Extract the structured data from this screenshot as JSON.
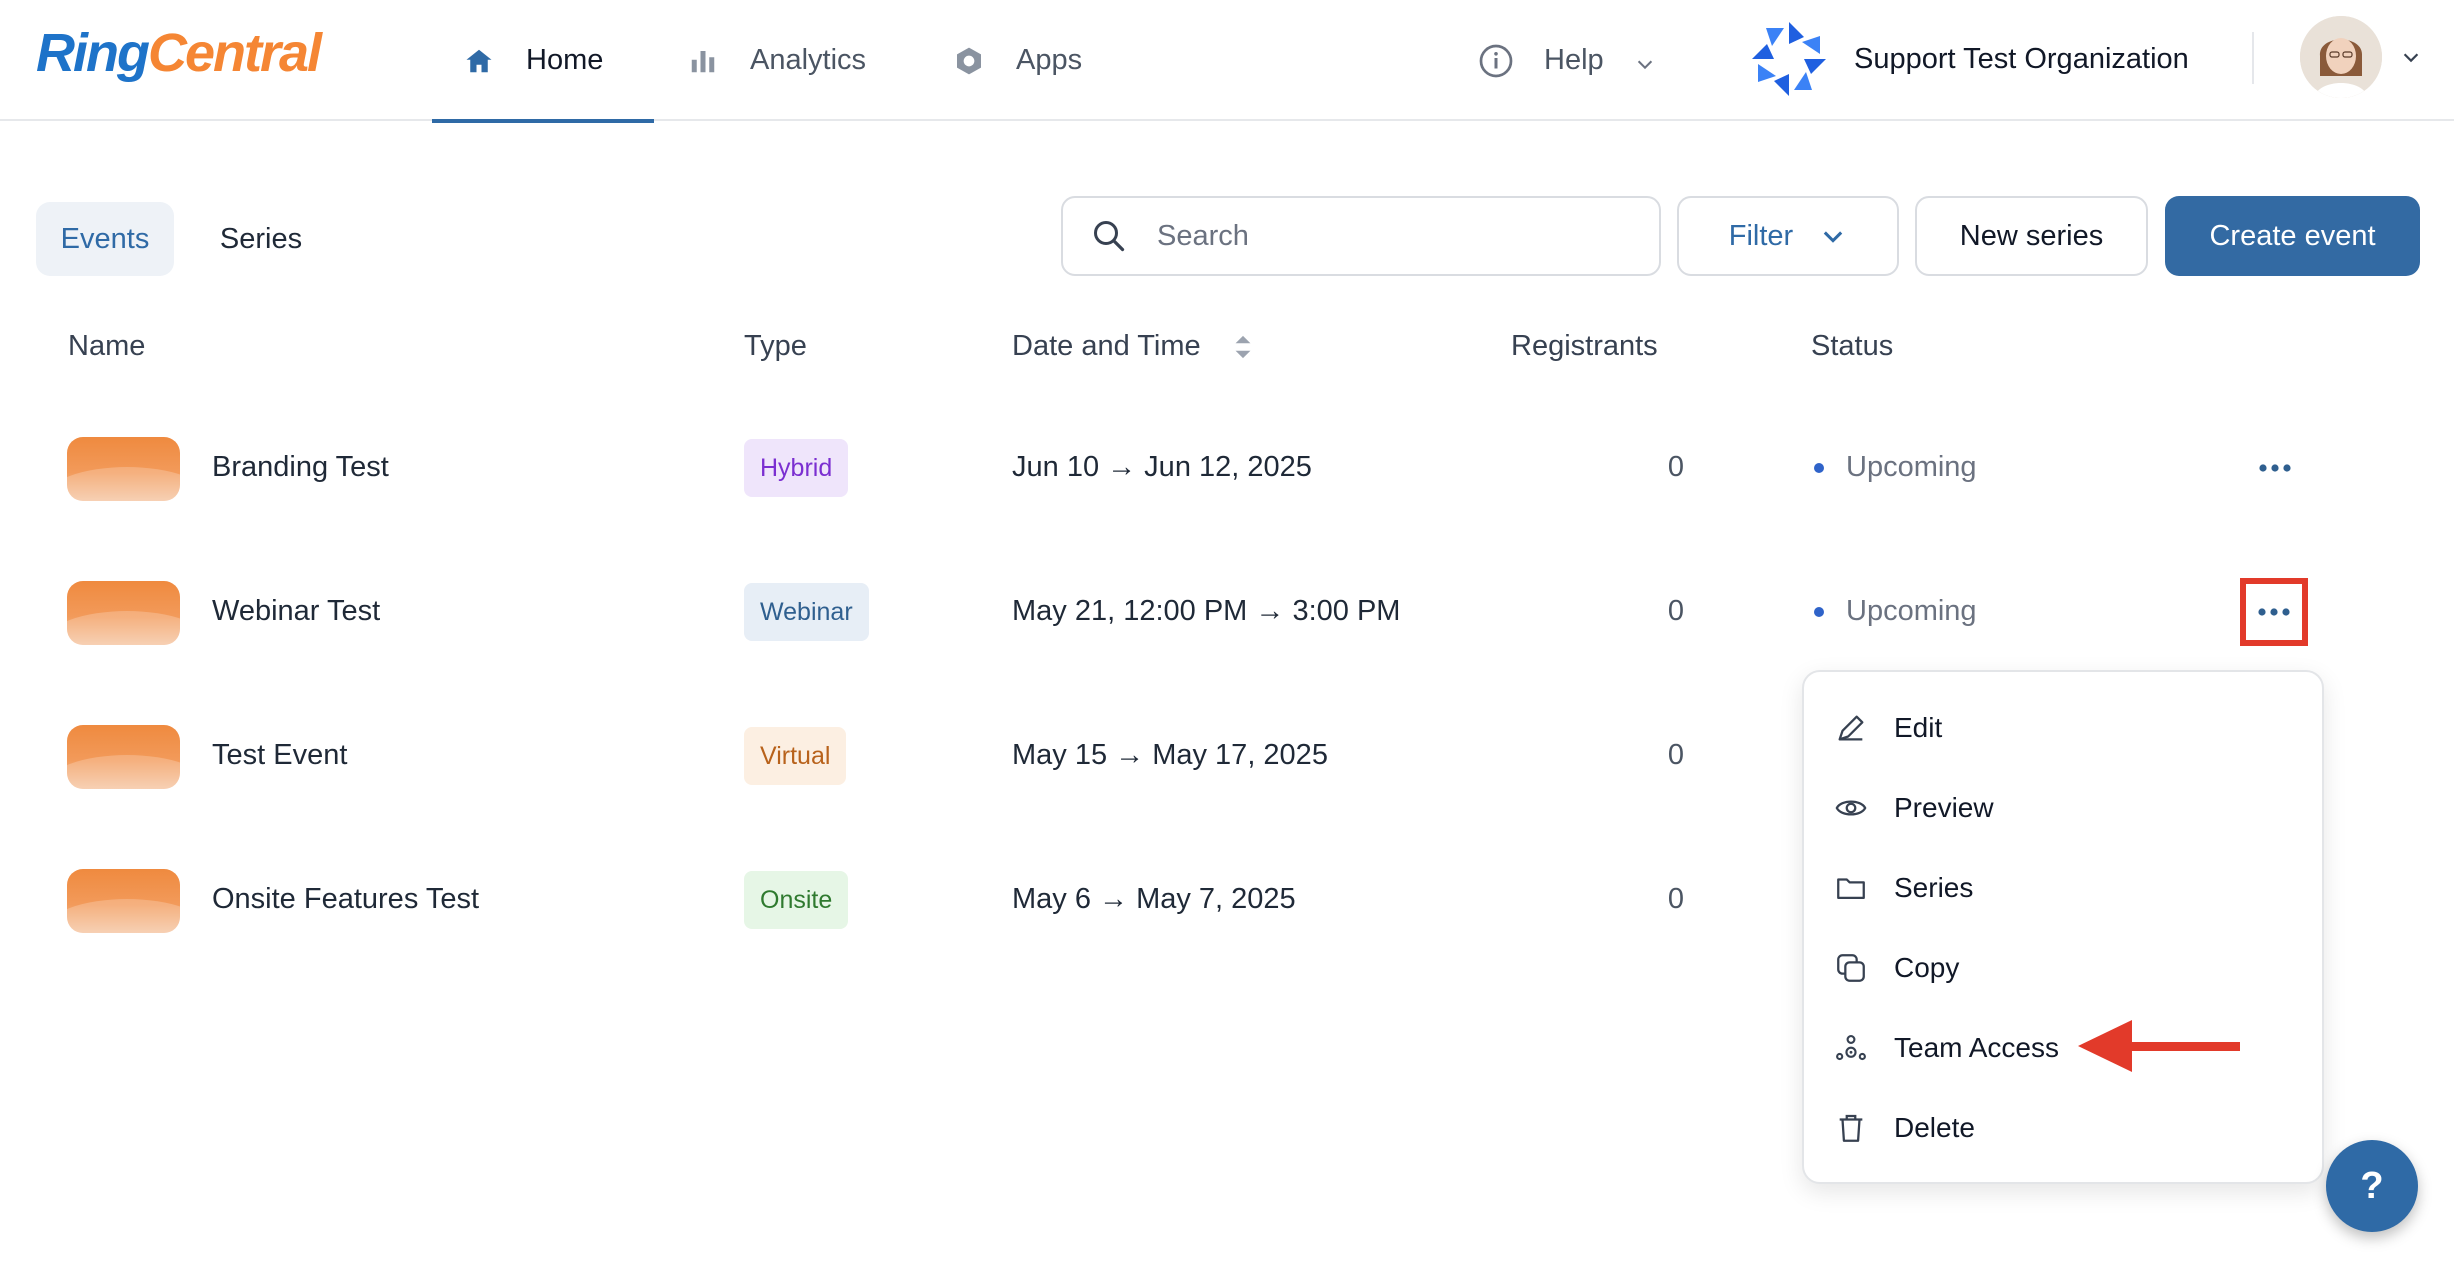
{
  "brand": {
    "part1": "Ring",
    "part2": "Central",
    "colors": {
      "blue": "#1e73c9",
      "orange": "#f58634"
    }
  },
  "nav": {
    "home": "Home",
    "analytics": "Analytics",
    "apps": "Apps",
    "help": "Help",
    "organization": "Support Test Organization"
  },
  "toolbar": {
    "tab_events": "Events",
    "tab_series": "Series",
    "search_placeholder": "Search",
    "filter_label": "Filter",
    "new_series_label": "New series",
    "create_event_label": "Create event",
    "accent": "#336aa3"
  },
  "table": {
    "columns": {
      "name": "Name",
      "type": "Type",
      "date": "Date and Time",
      "registrants": "Registrants",
      "status": "Status"
    },
    "rows": [
      {
        "name": "Branding Test",
        "type": "Hybrid",
        "date": "Jun 10 → Jun 12, 2025",
        "registrants": "0",
        "status": "Upcoming"
      },
      {
        "name": "Webinar Test",
        "type": "Webinar",
        "date": "May 21, 12:00 PM → 3:00 PM",
        "registrants": "0",
        "status": "Upcoming"
      },
      {
        "name": "Test Event",
        "type": "Virtual",
        "date": "May 15 → May 17, 2025",
        "registrants": "0",
        "status": ""
      },
      {
        "name": "Onsite Features Test",
        "type": "Onsite",
        "date": "May 6 → May 7, 2025",
        "registrants": "0",
        "status": ""
      }
    ]
  },
  "menu": {
    "edit": "Edit",
    "preview": "Preview",
    "series": "Series",
    "copy": "Copy",
    "team_access": "Team Access",
    "delete": "Delete"
  },
  "help_fab": "?",
  "annotation_color": "#e23a2a"
}
